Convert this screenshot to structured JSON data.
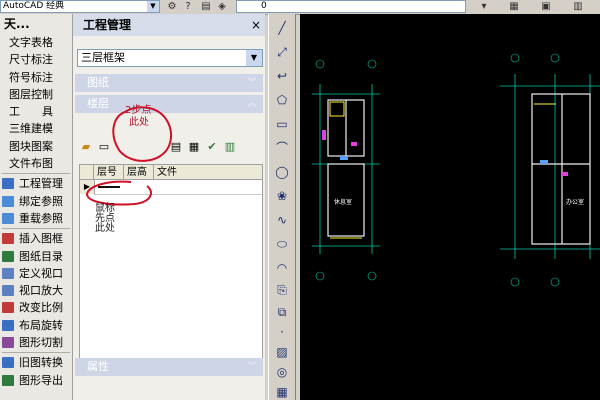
{
  "topbar": {
    "workspace": "AutoCAD 经典",
    "layer_value": "0"
  },
  "left_menu": {
    "header": "天...",
    "items": [
      {
        "label": "文字表格",
        "icon": false
      },
      {
        "label": "尺寸标注",
        "icon": false
      },
      {
        "label": "符号标注",
        "icon": false
      },
      {
        "label": "图层控制",
        "icon": false
      },
      {
        "label": "工　　具",
        "icon": false
      },
      {
        "label": "三维建模",
        "icon": false
      },
      {
        "label": "图块图案",
        "icon": false
      },
      {
        "label": "文件布图",
        "icon": false
      },
      {
        "label": "工程管理",
        "icon": true,
        "color": "#3a6fc4"
      },
      {
        "label": "绑定参照",
        "icon": true,
        "color": "#4c8bd6"
      },
      {
        "label": "重载参照",
        "icon": true,
        "color": "#4c8bd6"
      },
      {
        "label": "插入图框",
        "icon": true,
        "color": "#c23a3a"
      },
      {
        "label": "图纸目录",
        "icon": true,
        "color": "#2f7a3c"
      },
      {
        "label": "定义视口",
        "icon": true,
        "color": "#5e7fc0"
      },
      {
        "label": "视口放大",
        "icon": true,
        "color": "#5e7fc0"
      },
      {
        "label": "改变比例",
        "icon": true,
        "color": "#c23a3a"
      },
      {
        "label": "布局旋转",
        "icon": true,
        "color": "#3a6fc4"
      },
      {
        "label": "图形切割",
        "icon": true,
        "color": "#8a4a9c"
      },
      {
        "label": "旧图转换",
        "icon": true,
        "color": "#3a6fc4"
      },
      {
        "label": "图形导出",
        "icon": true,
        "color": "#2f7a3c"
      }
    ]
  },
  "panel": {
    "title": "工程管理",
    "close": "×",
    "project": "三层框架",
    "sections": {
      "drawings": "图纸",
      "floors": "楼层",
      "properties": "属性"
    },
    "table_headers": [
      "层号",
      "层高",
      "文件"
    ],
    "annotations": {
      "step2_line1": "2步点",
      "step2_line2": "此处",
      "step1_line1": "鼠标",
      "step1_line2": "先点",
      "step1_line3": "此处"
    }
  },
  "canvas": {
    "room_labels": [
      "休息室",
      "办公室"
    ]
  }
}
